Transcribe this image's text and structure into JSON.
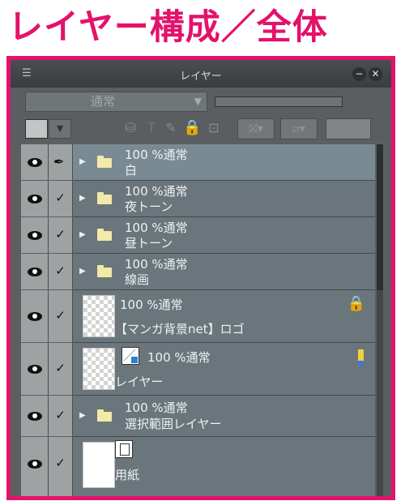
{
  "heading": "レイヤー構成／全体",
  "panel": {
    "title": "レイヤー",
    "menu_icon": "menu-icon",
    "blend_mode": "通常"
  },
  "layers": [
    {
      "opacity": "100 %通常",
      "name": "白",
      "type": "folder",
      "edit": "pen"
    },
    {
      "opacity": "100 %通常",
      "name": "夜トーン",
      "type": "folder",
      "edit": "check"
    },
    {
      "opacity": "100 %通常",
      "name": "昼トーン",
      "type": "folder",
      "edit": "check"
    },
    {
      "opacity": "100 %通常",
      "name": "線画",
      "type": "folder",
      "edit": "check"
    },
    {
      "opacity": "100 %通常",
      "name": "【マンガ背景net】ロゴ",
      "type": "raster-locked",
      "edit": "check"
    },
    {
      "opacity": "100 %通常",
      "name": "レイヤー",
      "type": "raster-active",
      "edit": "check"
    },
    {
      "opacity": "100 %通常",
      "name": "選択範囲レイヤー",
      "type": "folder",
      "edit": "check"
    },
    {
      "opacity": "",
      "name": "用紙",
      "type": "paper",
      "edit": "check"
    }
  ],
  "colors": {
    "accent": "#e3126b",
    "panel_bg": "#5b5f60",
    "row_bg": "#6b767c",
    "selected_row_bg": "#7a8a93",
    "eye_column_bg": "#9fa2a3"
  }
}
